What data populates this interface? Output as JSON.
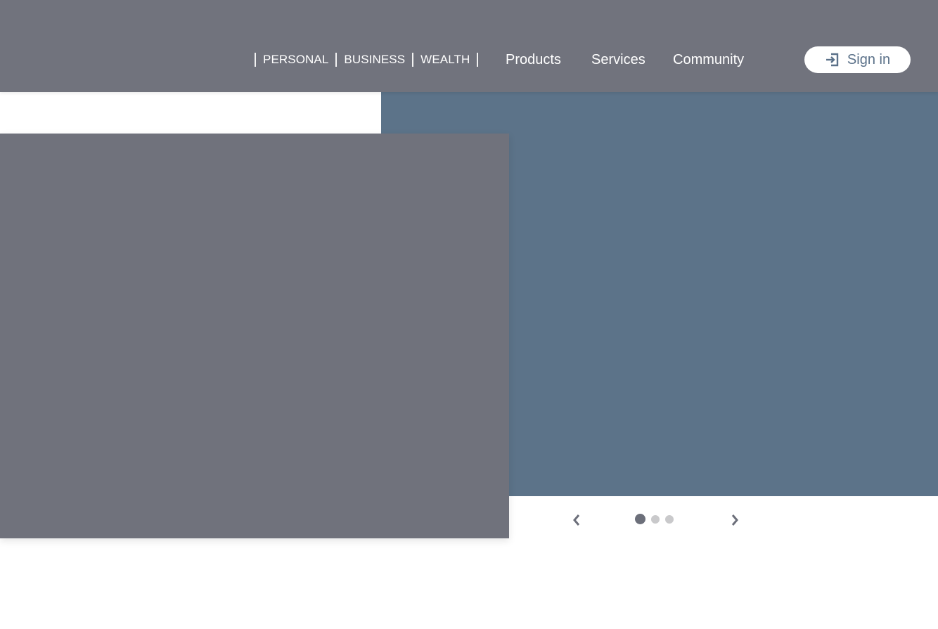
{
  "header": {
    "segments": [
      "PERSONAL",
      "BUSINESS",
      "WEALTH"
    ],
    "nav_items": [
      "Products",
      "Services",
      "Community"
    ],
    "signin": {
      "label": "Sign in",
      "icon": "sign-in-icon"
    }
  },
  "carousel": {
    "prev_icon": "chevron-left-icon",
    "next_icon": "chevron-right-icon",
    "total_slides": 3,
    "active_slide": 1
  },
  "colors": {
    "header_bg": "#71737d",
    "banner_bg": "#5c7389",
    "media_bg": "#70727c",
    "signin_text": "#5b7189",
    "dot_active": "#6c6f7a",
    "dot_inactive": "#c9c9cb"
  }
}
